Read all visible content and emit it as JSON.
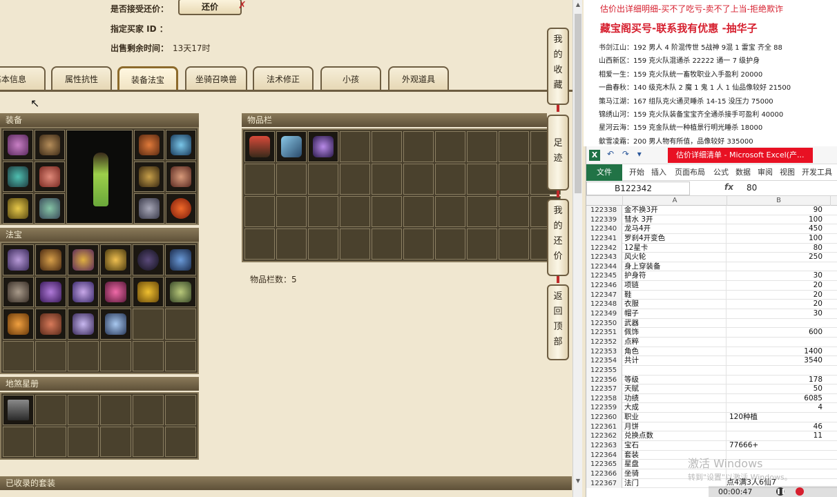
{
  "game": {
    "accept_haggle_label": "是否接受还价：",
    "haggle_button": "还价",
    "buyer_id_label": "指定买家 ID ：",
    "time_left_label": "出售剩余时间：",
    "time_left_value": "13天17时",
    "tabs": [
      "基本信息",
      "属性抗性",
      "装备法宝",
      "坐骑召唤兽",
      "法术修正",
      "小孩",
      "外观道具"
    ],
    "active_tab": "装备法宝",
    "equipment_title": "装备",
    "treasure_title": "法宝",
    "star_title": "地煞星册",
    "inventory_title": "物品栏",
    "inventory_count_label": "物品栏数：5",
    "collected_title": "已收录的套装",
    "side_tabs": [
      "我的收藏",
      "足迹",
      "我的还价",
      "返回顶部"
    ]
  },
  "notes": {
    "line1": "估价出详细明细-买不了吃亏-卖不了上当-拒绝欺诈",
    "line2": "藏宝阁买号-联系我有优惠 -抽华子",
    "items": [
      "书剑江山：192 男人 4 阶混传世  5战神  9混 1 雷宝 齐全  88",
      "山西新区：159 克火队混通杀 22222 通一 7 级护身",
      "相爱一生：159 克火队统一畜牧职业入手盈利 20000",
      "一曲春秋：140 级克木队 2 魔 1 鬼 1 人 1 仙品像较好 21500",
      "策马江湖：167 组队克火通灵睡杀 14-15 没压力 75000",
      "锦绣山河：159 克火队装备宝宝齐全通杀接手可盈利 40000",
      "星河云海：159 克金队统一种植景行明光睡杀 18000",
      "歙雪凌霜：200 男人物有所值，品像较好 335000"
    ]
  },
  "excel": {
    "title": "估价详细清单 - Microsoft Excel(产...",
    "app_icon": "X",
    "ribbon_file": "文件",
    "ribbon_tabs": [
      "开始",
      "插入",
      "页面布局",
      "公式",
      "数据",
      "审阅",
      "视图",
      "开发工具"
    ],
    "name_box": "B122342",
    "fx": "fx",
    "formula_value": "80",
    "col_a": "A",
    "col_b": "B",
    "rows": [
      [
        "122338",
        "金不换3开",
        "90"
      ],
      [
        "122339",
        "彗水  3开",
        "100"
      ],
      [
        "122340",
        "龙马4开",
        "450"
      ],
      [
        "122341",
        "罗刹4开变色",
        "100"
      ],
      [
        "122342",
        "12星卡",
        "80"
      ],
      [
        "122343",
        "风火轮",
        "250"
      ],
      [
        "122344",
        "身上穿装备",
        ""
      ],
      [
        "122345",
        "护身符",
        "30"
      ],
      [
        "122346",
        "项链",
        "20"
      ],
      [
        "122347",
        "鞋",
        "20"
      ],
      [
        "122348",
        "衣服",
        "20"
      ],
      [
        "122349",
        "帽子",
        "30"
      ],
      [
        "122350",
        "武器",
        ""
      ],
      [
        "122351",
        "佩饰",
        "600"
      ],
      [
        "122352",
        "点粹",
        ""
      ],
      [
        "122353",
        "角色",
        "1400"
      ],
      [
        "122354",
        "共计",
        "3540"
      ],
      [
        "122355",
        "",
        ""
      ],
      [
        "122356",
        "等级",
        "178"
      ],
      [
        "122357",
        "天赋",
        "50"
      ],
      [
        "122358",
        "功绩",
        "6085"
      ],
      [
        "122359",
        "大成",
        "4"
      ],
      [
        "122360",
        "职业",
        "120种植"
      ],
      [
        "122361",
        "月饼",
        "46"
      ],
      [
        "122362",
        "兑换点数",
        "11"
      ],
      [
        "122363",
        "宝石",
        "77666+"
      ],
      [
        "122364",
        "套装",
        ""
      ],
      [
        "122365",
        "星盘",
        ""
      ],
      [
        "122366",
        "坐骑",
        ""
      ],
      [
        "122367",
        "法门",
        ""
      ]
    ],
    "watermark": "激活 Windows",
    "watermark_sub": "转到\"设置\"以激活 Windows。",
    "overlay_note": "点4满3人6仙7",
    "recording_time": "00:00:47"
  },
  "colors": {
    "accent_red": "#d61f2e",
    "excel_green": "#217346",
    "panel_brown": "#463d2b"
  }
}
